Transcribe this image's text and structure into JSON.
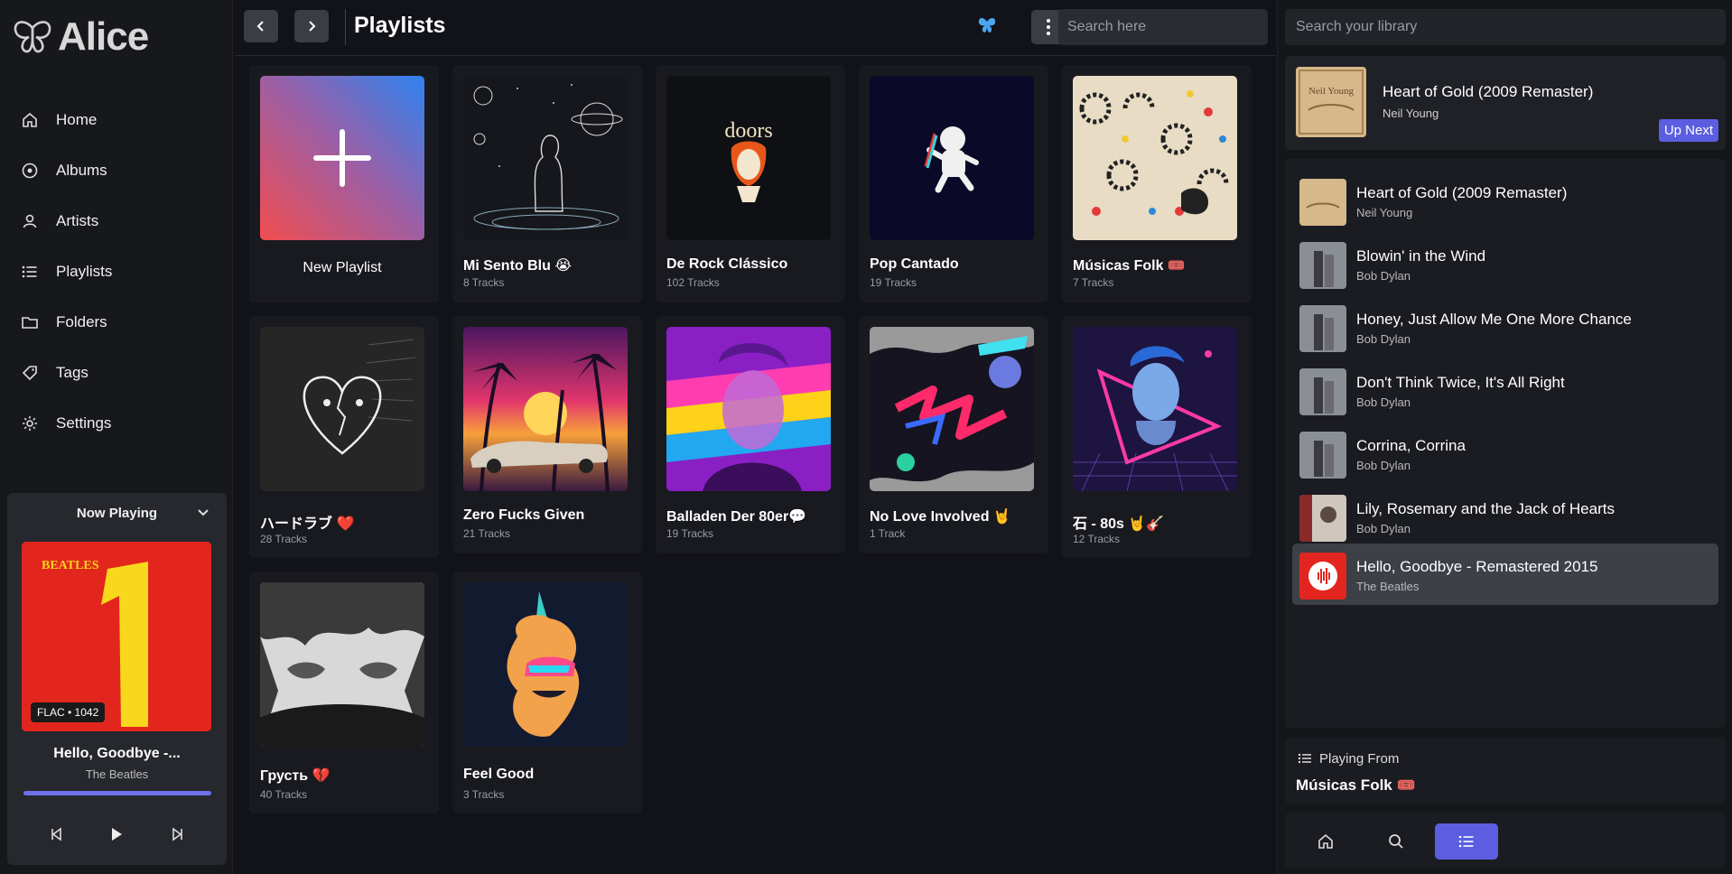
{
  "app": {
    "name": "Alice"
  },
  "nav": [
    {
      "id": "home",
      "label": "Home",
      "icon": "home-icon"
    },
    {
      "id": "albums",
      "label": "Albums",
      "icon": "disc-icon"
    },
    {
      "id": "artists",
      "label": "Artists",
      "icon": "user-icon"
    },
    {
      "id": "playlists",
      "label": "Playlists",
      "icon": "list-icon"
    },
    {
      "id": "folders",
      "label": "Folders",
      "icon": "folder-icon"
    },
    {
      "id": "tags",
      "label": "Tags",
      "icon": "tag-icon"
    },
    {
      "id": "settings",
      "label": "Settings",
      "icon": "gear-icon"
    }
  ],
  "now_playing": {
    "header": "Now Playing",
    "badge": "FLAC • 1042",
    "title": "Hello, Goodbye -...",
    "artist": "The Beatles",
    "progress": 1.0
  },
  "header": {
    "title": "Playlists",
    "search_placeholder": "Search here"
  },
  "playlists": [
    {
      "name": "New Playlist",
      "count": "",
      "new": true
    },
    {
      "name": "Mi Sento Blu 😭",
      "count": "8 Tracks"
    },
    {
      "name": "De Rock Clássico",
      "count": "102 Tracks"
    },
    {
      "name": "Pop Cantado",
      "count": "19 Tracks"
    },
    {
      "name": "Músicas Folk 🎟️",
      "count": "7 Tracks"
    },
    {
      "name": "ハードラブ ❤️",
      "count": "28 Tracks"
    },
    {
      "name": "Zero Fucks Given",
      "count": "21 Tracks"
    },
    {
      "name": "Balladen Der 80er💬",
      "count": "19 Tracks"
    },
    {
      "name": "No Love Involved 🤘",
      "count": "1 Track"
    },
    {
      "name": "石 - 80s 🤘🎸",
      "count": "12 Tracks"
    },
    {
      "name": "Грусть 💔",
      "count": "40 Tracks"
    },
    {
      "name": "Feel Good",
      "count": "3 Tracks"
    }
  ],
  "right": {
    "search_placeholder": "Search your library",
    "up_next": {
      "title": "Heart of Gold (2009 Remaster)",
      "artist": "Neil Young",
      "button": "Up Next"
    },
    "queue": [
      {
        "title": "Heart of Gold (2009 Remaster)",
        "artist": "Neil Young"
      },
      {
        "title": "Blowin' in the Wind",
        "artist": "Bob Dylan"
      },
      {
        "title": "Honey, Just Allow Me One More Chance",
        "artist": "Bob Dylan"
      },
      {
        "title": "Don't Think Twice, It's All Right",
        "artist": "Bob Dylan"
      },
      {
        "title": "Corrina, Corrina",
        "artist": "Bob Dylan"
      },
      {
        "title": "Lily, Rosemary and the Jack of Hearts",
        "artist": "Bob Dylan"
      },
      {
        "title": "Hello, Goodbye - Remastered 2015",
        "artist": "The Beatles",
        "active": true
      }
    ],
    "playing_from": {
      "label": "Playing From",
      "name": "Músicas Folk 🎟️"
    }
  },
  "colors": {
    "accent": "#5b5ee0",
    "background": "#111318",
    "sidebar": "#17181c"
  }
}
